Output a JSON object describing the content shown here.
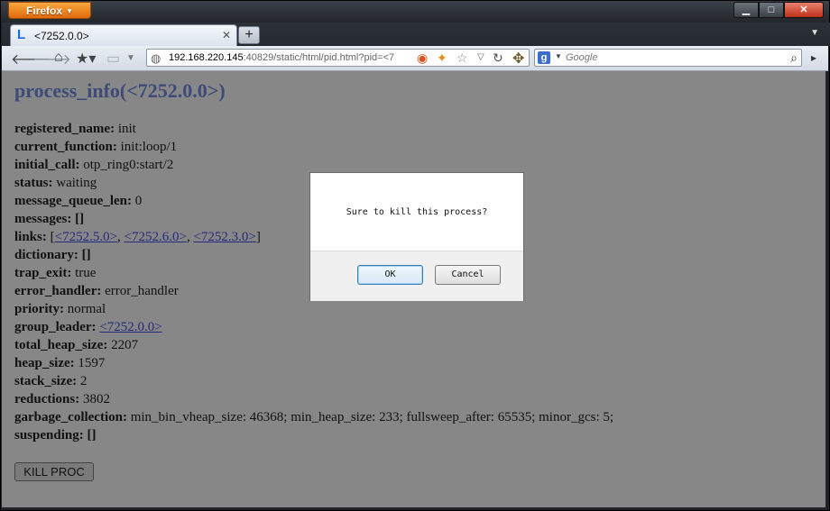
{
  "browser": {
    "menu_button": "Firefox",
    "tab_title": "<7252.0.0>",
    "tab_icon": "L",
    "url_host": "192.168.220.145",
    "url_rest": ":40829/static/html/pid.html?pid=<7",
    "search_engine_badge": "g",
    "search_placeholder": "Google"
  },
  "page": {
    "title": "process_info(<7252.0.0>)",
    "fields": [
      {
        "key": "registered_name:",
        "value": "init"
      },
      {
        "key": "current_function:",
        "value": "init:loop/1"
      },
      {
        "key": "initial_call:",
        "value": "otp_ring0:start/2"
      },
      {
        "key": "status:",
        "value": "waiting"
      },
      {
        "key": "message_queue_len:",
        "value": "0"
      },
      {
        "key": "messages: []",
        "value": ""
      },
      {
        "key": "links:",
        "prefix": "[",
        "links": [
          "<7252.5.0>",
          "<7252.6.0>",
          "<7252.3.0>"
        ],
        "suffix": "]"
      },
      {
        "key": "dictionary: []",
        "value": ""
      },
      {
        "key": "trap_exit:",
        "value": "true"
      },
      {
        "key": "error_handler:",
        "value": "error_handler"
      },
      {
        "key": "priority:",
        "value": "normal"
      },
      {
        "key": "group_leader:",
        "links": [
          "<7252.0.0>"
        ]
      },
      {
        "key": "total_heap_size:",
        "value": "2207"
      },
      {
        "key": "heap_size:",
        "value": "1597"
      },
      {
        "key": "stack_size:",
        "value": "2"
      },
      {
        "key": "reductions:",
        "value": "3802"
      },
      {
        "key": "garbage_collection:",
        "value": "min_bin_vheap_size: 46368; min_heap_size: 233; fullsweep_after: 65535; minor_gcs: 5;"
      },
      {
        "key": "suspending: []",
        "value": ""
      }
    ],
    "kill_button": "KILL PROC"
  },
  "dialog": {
    "message": "Sure to kill this process?",
    "ok_label": "OK",
    "cancel_label": "Cancel"
  },
  "colors": {
    "page_background": "#878787",
    "title_color": "#3e4a78",
    "link_color": "#262a7e",
    "firefox_orange": "#e06a0b"
  }
}
